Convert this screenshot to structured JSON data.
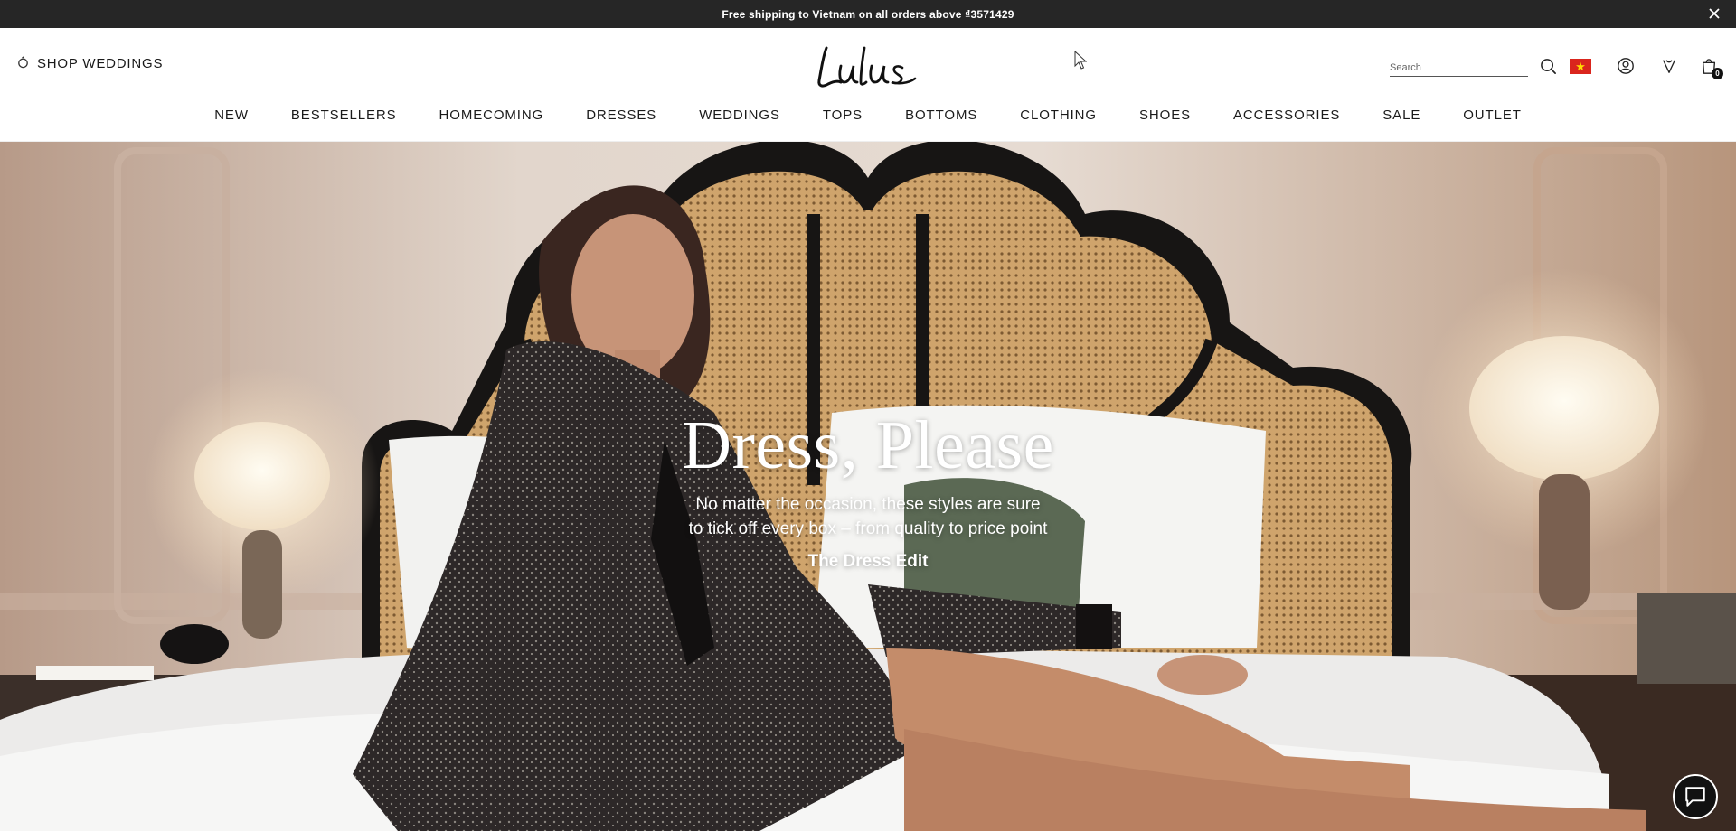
{
  "promo": {
    "text": "Free shipping to Vietnam on all orders above ₫3571429",
    "close_icon": "close-icon"
  },
  "header": {
    "shop_weddings_label": "SHOP WEDDINGS",
    "shop_weddings_icon": "ring-icon",
    "logo_text": "Lulus",
    "search_placeholder": "Search",
    "search_icon": "search-icon",
    "country_flag": "vietnam-flag-icon",
    "account_icon": "account-icon",
    "wishlist_icon": "wishlist-icon",
    "cart_icon": "shopping-bag-icon",
    "cart_count": "0"
  },
  "nav": {
    "items": [
      {
        "label": "NEW"
      },
      {
        "label": "BESTSELLERS"
      },
      {
        "label": "HOMECOMING"
      },
      {
        "label": "DRESSES"
      },
      {
        "label": "WEDDINGS"
      },
      {
        "label": "TOPS"
      },
      {
        "label": "BOTTOMS"
      },
      {
        "label": "CLOTHING"
      },
      {
        "label": "SHOES"
      },
      {
        "label": "ACCESSORIES"
      },
      {
        "label": "SALE"
      },
      {
        "label": "OUTLET"
      }
    ]
  },
  "hero": {
    "title": "Dress, Please",
    "subtitle_line1": "No matter the occasion, these styles are sure",
    "subtitle_line2": "to tick off every box – from quality to price point",
    "cta_label": "The Dress Edit"
  },
  "chat": {
    "icon": "chat-icon"
  },
  "colors": {
    "promo_bg": "#262626",
    "flag_red": "#da251d",
    "flag_star": "#ffdd00",
    "chat_bg": "#111111"
  }
}
